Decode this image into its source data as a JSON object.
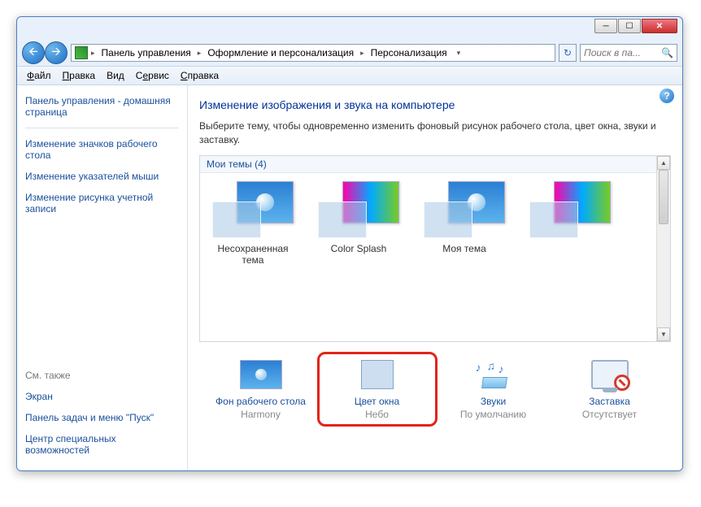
{
  "breadcrumbs": {
    "b1": "Панель управления",
    "b2": "Оформление и персонализация",
    "b3": "Персонализация"
  },
  "search": {
    "placeholder": "Поиск в па..."
  },
  "menus": {
    "file": "Файл",
    "edit": "Правка",
    "view": "Вид",
    "service": "Сервис",
    "help": "Справка"
  },
  "sidebar": {
    "title": "Панель управления - домашняя страница",
    "links": [
      "Изменение значков рабочего стола",
      "Изменение указателей мыши",
      "Изменение рисунка учетной записи"
    ],
    "also": "См. также",
    "footer": [
      "Экран",
      "Панель задач и меню \"Пуск\"",
      "Центр специальных возможностей"
    ]
  },
  "main": {
    "heading": "Изменение изображения и звука на компьютере",
    "desc": "Выберите тему, чтобы одновременно изменить фоновый рисунок рабочего стола, цвет окна, звуки и заставку.",
    "themes_header": "Мои темы (4)",
    "themes": [
      {
        "label": "Несохраненная тема",
        "kind": "win7",
        "selected": true
      },
      {
        "label": "Color Splash",
        "kind": "splash",
        "selected": false
      },
      {
        "label": "Моя тема",
        "kind": "win7",
        "selected": false
      },
      {
        "label": "",
        "kind": "splash",
        "selected": false
      }
    ]
  },
  "bottom": [
    {
      "label": "Фон рабочего стола",
      "sub": "Harmony",
      "icon": "wall",
      "hl": false
    },
    {
      "label": "Цвет окна",
      "sub": "Небо",
      "icon": "glass",
      "hl": true
    },
    {
      "label": "Звуки",
      "sub": "По умолчанию",
      "icon": "sound",
      "hl": false
    },
    {
      "label": "Заставка",
      "sub": "Отсутствует",
      "icon": "saver",
      "hl": false
    }
  ]
}
